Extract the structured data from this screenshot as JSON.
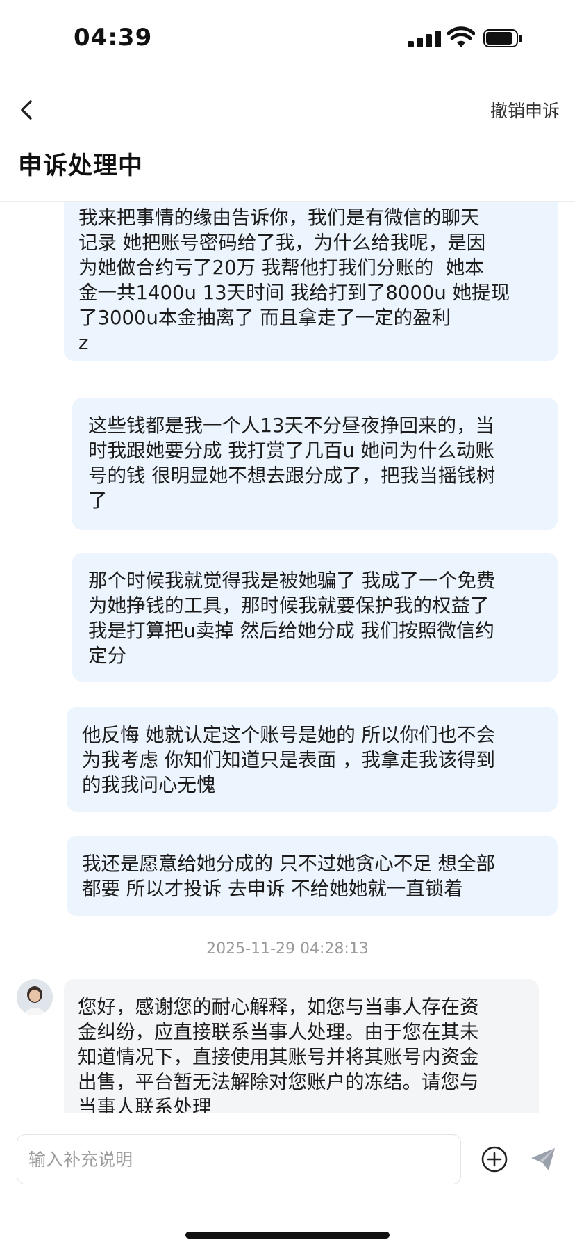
{
  "status": {
    "time": "04:39"
  },
  "header": {
    "cancel_label": "撤销申诉",
    "title": "申诉处理中"
  },
  "messages": [
    "我来把事情的缘由告诉你，我们是有微信的聊天\n记录 她把账号密码给了我，为什么给我呢，是因\n为她做合约亏了20万 我帮他打我们分账的  她本\n金一共1400u 13天时间 我给打到了8000u 她提现\n了3000u本金抽离了 而且拿走了一定的盈利\nz",
    "这些钱都是我一个人13天不分昼夜挣回来的，当\n时我跟她要分成 我打赏了几百u 她问为什么动账\n号的钱 很明显她不想去跟分成了，把我当摇钱树\n了",
    "那个时候我就觉得我是被她骗了 我成了一个免费\n为她挣钱的工具，那时候我就要保护我的权益了\n我是打算把u卖掉 然后给她分成 我们按照微信约\n定分",
    "他反悔 她就认定这个账号是她的 所以你们也不会\n为我考虑 你知们知道只是表面 ，我拿走我该得到\n的我我问心无愧",
    "我还是愿意给她分成的 只不过她贪心不足 想全部\n都要 所以才投诉 去申诉 不给她她就一直锁着"
  ],
  "timestamp": "2025-11-29 04:28:13",
  "reply": "您好，感谢您的耐心解释，如您与当事人存在资\n金纠纷，应直接联系当事人处理。由于您在其未\n知道情况下，直接使用其账号并将其账号内资金\n出售，平台暂无法解除对您账户的冻结。请您与\n当事人联系处理",
  "input": {
    "placeholder": "输入补充说明",
    "value": ""
  },
  "colors": {
    "bubble": "#ecf4fd",
    "reply_bubble": "#f4f5f7",
    "timestamp": "#9a9a9a"
  },
  "icons": {
    "back": "chevron-left-icon",
    "add": "plus-circle-icon",
    "send": "paper-plane-icon"
  }
}
